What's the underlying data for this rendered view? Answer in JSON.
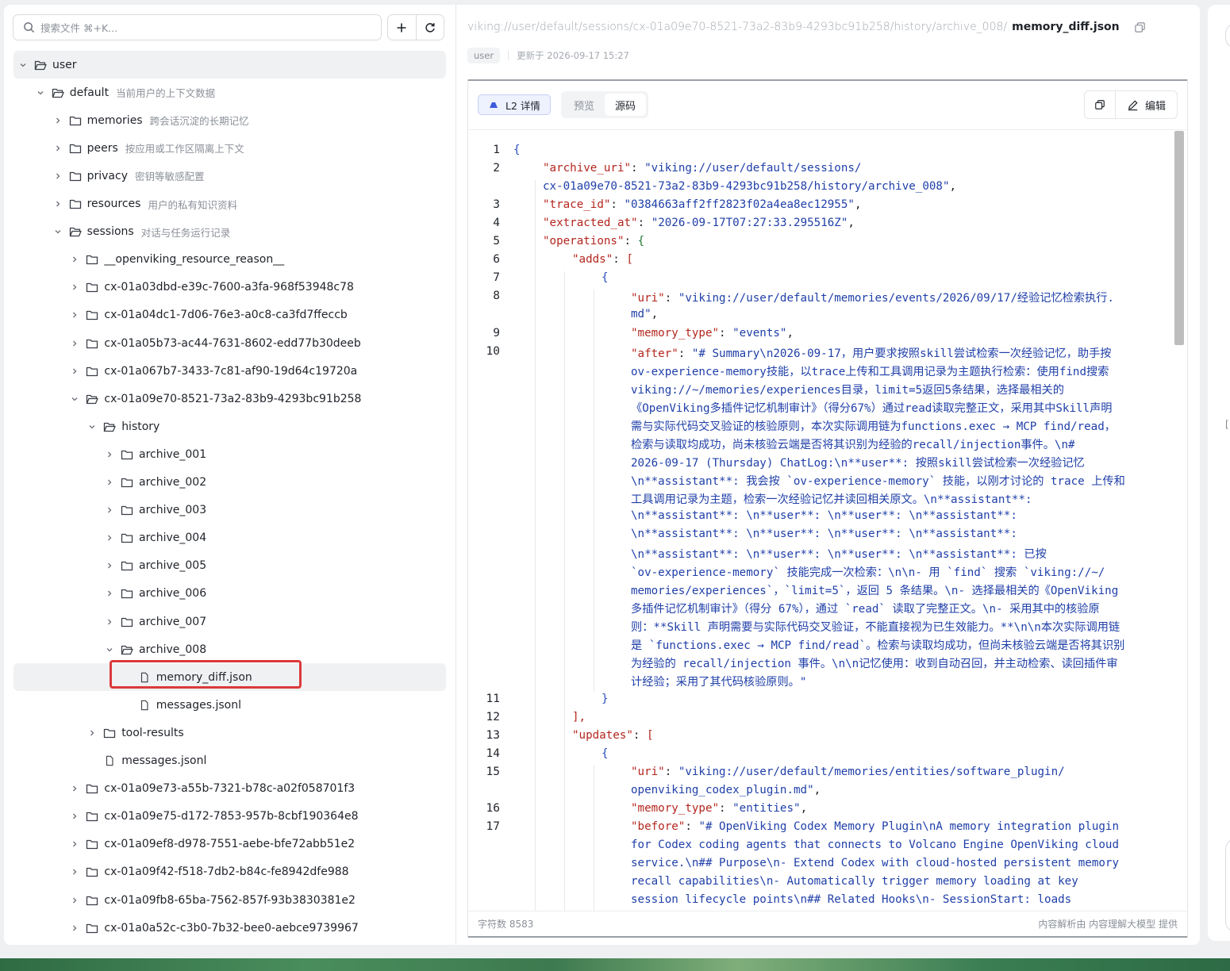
{
  "sidebar": {
    "search_placeholder": "搜索文件 ⌘+K...",
    "tree": [
      {
        "name": "user",
        "desc": "",
        "type": "folder",
        "state": "open",
        "active": true
      },
      {
        "name": "default",
        "desc": "当前用户的上下文数据",
        "type": "folder",
        "state": "open"
      },
      {
        "name": "memories",
        "desc": "跨会话沉淀的长期记忆",
        "type": "folder",
        "state": "closed"
      },
      {
        "name": "peers",
        "desc": "按应用或工作区隔离上下文",
        "type": "folder",
        "state": "closed"
      },
      {
        "name": "privacy",
        "desc": "密钥等敏感配置",
        "type": "folder",
        "state": "closed"
      },
      {
        "name": "resources",
        "desc": "用户的私有知识资料",
        "type": "folder",
        "state": "closed"
      },
      {
        "name": "sessions",
        "desc": "对话与任务运行记录",
        "type": "folder",
        "state": "open"
      },
      {
        "name": "__openviking_resource_reason__",
        "desc": "",
        "type": "folder",
        "state": "closed"
      },
      {
        "name": "cx-01a03dbd-e39c-7600-a3fa-968f53948c78",
        "desc": "",
        "type": "folder",
        "state": "closed"
      },
      {
        "name": "cx-01a04dc1-7d06-76e3-a0c8-ca3fd7ffeccb",
        "desc": "",
        "type": "folder",
        "state": "closed"
      },
      {
        "name": "cx-01a05b73-ac44-7631-8602-edd77b30deeb",
        "desc": "",
        "type": "folder",
        "state": "closed"
      },
      {
        "name": "cx-01a067b7-3433-7c81-af90-19d64c19720a",
        "desc": "",
        "type": "folder",
        "state": "closed"
      },
      {
        "name": "cx-01a09e70-8521-73a2-83b9-4293bc91b258",
        "desc": "",
        "type": "folder",
        "state": "open"
      },
      {
        "name": "history",
        "desc": "",
        "type": "folder",
        "state": "open"
      },
      {
        "name": "archive_001",
        "desc": "",
        "type": "folder",
        "state": "closed"
      },
      {
        "name": "archive_002",
        "desc": "",
        "type": "folder",
        "state": "closed"
      },
      {
        "name": "archive_003",
        "desc": "",
        "type": "folder",
        "state": "closed"
      },
      {
        "name": "archive_004",
        "desc": "",
        "type": "folder",
        "state": "closed"
      },
      {
        "name": "archive_005",
        "desc": "",
        "type": "folder",
        "state": "closed"
      },
      {
        "name": "archive_006",
        "desc": "",
        "type": "folder",
        "state": "closed"
      },
      {
        "name": "archive_007",
        "desc": "",
        "type": "folder",
        "state": "closed"
      },
      {
        "name": "archive_008",
        "desc": "",
        "type": "folder",
        "state": "open"
      },
      {
        "name": "memory_diff.json",
        "desc": "",
        "type": "file",
        "state": "none",
        "active": true
      },
      {
        "name": "messages.jsonl",
        "desc": "",
        "type": "file",
        "state": "none"
      },
      {
        "name": "tool-results",
        "desc": "",
        "type": "folder",
        "state": "closed"
      },
      {
        "name": "messages.jsonl",
        "desc": "",
        "type": "file",
        "state": "none"
      },
      {
        "name": "cx-01a09e73-a55b-7321-b78c-a02f058701f3",
        "desc": "",
        "type": "folder",
        "state": "closed"
      },
      {
        "name": "cx-01a09e75-d172-7853-957b-8cbf190364e8",
        "desc": "",
        "type": "folder",
        "state": "closed"
      },
      {
        "name": "cx-01a09ef8-d978-7551-aebe-bfe72abb51e2",
        "desc": "",
        "type": "folder",
        "state": "closed"
      },
      {
        "name": "cx-01a09f42-f518-7db2-b84c-fe8942dfe988",
        "desc": "",
        "type": "folder",
        "state": "closed"
      },
      {
        "name": "cx-01a09fb8-65ba-7562-857f-93b3830381e2",
        "desc": "",
        "type": "folder",
        "state": "closed"
      },
      {
        "name": "cx-01a0a52c-c3b0-7b32-bee0-aebce9739967",
        "desc": "",
        "type": "folder",
        "state": "closed"
      }
    ]
  },
  "header": {
    "path_prefix": "viking://user/default/sessions/cx-01a09e70-8521-73a2-83b9-4293bc91b258/history/archive_008/",
    "file_name": "memory_diff.json",
    "tag": "user",
    "updated": "更新于 2026-09-17 15:27"
  },
  "viewer": {
    "l2_label": "L2 详情",
    "tabs": [
      "预览",
      "源码"
    ],
    "active_tab": "源码",
    "edit_label": "编辑",
    "char_count": "字符数 8583",
    "footer_note": "内容解析由 内容理解大模型 提供"
  },
  "code": {
    "line_numbers": [
      "1",
      "2",
      "",
      "3",
      "4",
      "5",
      "6",
      "7",
      "8",
      "",
      "9",
      "10",
      "",
      "",
      "",
      "",
      "",
      "",
      "",
      "",
      "",
      "",
      "",
      "",
      "",
      "",
      "",
      "",
      "",
      "",
      "11",
      "12",
      "13",
      "14",
      "15",
      "",
      "16",
      "17",
      "",
      "",
      "",
      ""
    ],
    "lines": [
      {
        "i": 0,
        "t": "{"
      },
      {
        "i": 1,
        "t": "\"archive_uri\": \"viking://user/default/sessions/"
      },
      {
        "i": 1,
        "t": "cx-01a09e70-8521-73a2-83b9-4293bc91b258/history/archive_008\","
      },
      {
        "i": 1,
        "t": "\"trace_id\": \"0384663aff2ff2823f02a4ea8ec12955\","
      },
      {
        "i": 1,
        "t": "\"extracted_at\": \"2026-09-17T07:27:33.295516Z\","
      },
      {
        "i": 1,
        "t": "\"operations\": {"
      },
      {
        "i": 2,
        "t": "\"adds\": ["
      },
      {
        "i": 3,
        "t": "{"
      },
      {
        "i": 4,
        "t": "\"uri\": \"viking://user/default/memories/events/2026/09/17/经验记忆检索执行."
      },
      {
        "i": 4,
        "t": "md\","
      },
      {
        "i": 4,
        "t": "\"memory_type\": \"events\","
      },
      {
        "i": 4,
        "t": "\"after\": \"# Summary\\n2026-09-17，用户要求按照skill尝试检索一次经验记忆，助手按"
      },
      {
        "i": 4,
        "t": "ov-experience-memory技能，以trace上传和工具调用记录为主题执行检索：使用find搜索"
      },
      {
        "i": 4,
        "t": "viking://~/memories/experiences目录，limit=5返回5条结果，选择最相关的"
      },
      {
        "i": 4,
        "t": "《OpenViking多插件记忆机制审计》（得分67%）通过read读取完整正文，采用其中Skill声明"
      },
      {
        "i": 4,
        "t": "需与实际代码交叉验证的核验原则，本次实际调用链为functions.exec → MCP find/read，"
      },
      {
        "i": 4,
        "t": "检索与读取均成功，尚未核验云端是否将其识别为经验的recall/injection事件。\\n#"
      },
      {
        "i": 4,
        "t": "2026-09-17 (Thursday) ChatLog:\\n**user**: 按照skill尝试检索一次经验记忆"
      },
      {
        "i": 4,
        "t": "\\n**assistant**: 我会按 `ov-experience-memory` 技能，以刚才讨论的 trace 上传和"
      },
      {
        "i": 4,
        "t": "工具调用记录为主题，检索一次经验记忆并读回相关原文。\\n**assistant**:"
      },
      {
        "i": 4,
        "t": "\\n**assistant**: \\n**user**: \\n**user**: \\n**assistant**:"
      },
      {
        "i": 4,
        "t": "\\n**assistant**: \\n**user**: \\n**user**: \\n**assistant**:"
      },
      {
        "i": 4,
        "t": "\\n**assistant**: \\n**user**: \\n**user**: \\n**assistant**: 已按"
      },
      {
        "i": 4,
        "t": "`ov-experience-memory` 技能完成一次检索：\\n\\n- 用 `find` 搜索 `viking://~/"
      },
      {
        "i": 4,
        "t": "memories/experiences`，`limit=5`，返回 5 条结果。\\n- 选择最相关的《OpenViking"
      },
      {
        "i": 4,
        "t": "多插件记忆机制审计》（得分 67%），通过 `read` 读取了完整正文。\\n- 采用其中的核验原"
      },
      {
        "i": 4,
        "t": "则：**Skill 声明需要与实际代码交叉验证，不能直接视为已生效能力。**\\n\\n本次实际调用链"
      },
      {
        "i": 4,
        "t": "是 `functions.exec → MCP find/read`。检索与读取均成功，但尚未核验云端是否将其识别"
      },
      {
        "i": 4,
        "t": "为经验的 recall/injection 事件。\\n\\n记忆使用：收到自动召回，并主动检索、读回插件审"
      },
      {
        "i": 4,
        "t": "计经验；采用了其代码核验原则。\""
      },
      {
        "i": 3,
        "t": "}"
      },
      {
        "i": 2,
        "t": "],"
      },
      {
        "i": 2,
        "t": "\"updates\": ["
      },
      {
        "i": 3,
        "t": "{"
      },
      {
        "i": 4,
        "t": "\"uri\": \"viking://user/default/memories/entities/software_plugin/"
      },
      {
        "i": 4,
        "t": "openviking_codex_plugin.md\","
      },
      {
        "i": 4,
        "t": "\"memory_type\": \"entities\","
      },
      {
        "i": 4,
        "t": "\"before\": \"# OpenViking Codex Memory Plugin\\nA memory integration plugin"
      },
      {
        "i": 4,
        "t": "for Codex coding agents that connects to Volcano Engine OpenViking cloud"
      },
      {
        "i": 4,
        "t": "service.\\n## Purpose\\n- Extend Codex with cloud-hosted persistent memory"
      },
      {
        "i": 4,
        "t": "recall capabilities\\n- Automatically trigger memory loading at key"
      },
      {
        "i": 4,
        "t": "session lifecycle points\\n## Related Hooks\\n- SessionStart: loads"
      }
    ]
  }
}
